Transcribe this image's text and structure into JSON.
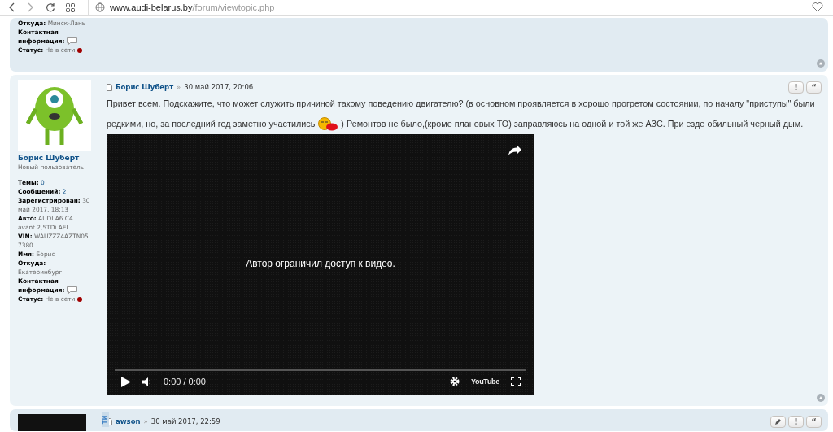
{
  "browser": {
    "url_host": "www.audi-belarus.by",
    "url_path": "/forum/viewtopic.php"
  },
  "posts": [
    {
      "kind": "tail",
      "fields": [
        {
          "label": "Откуда:",
          "value": "Минск-Лань"
        },
        {
          "label": "Контактная информация:",
          "kind": "contact"
        },
        {
          "label": "Статус:",
          "value": "Не в сети",
          "kind": "status",
          "online": false
        }
      ]
    },
    {
      "kind": "full",
      "profile_name": "Борис Шуберт",
      "author": "Борис Шуберт",
      "rank": "Новый пользователь",
      "separator": "»",
      "date": "30 май 2017, 20:06",
      "buttons": [
        {
          "kind": "text",
          "label": "!"
        },
        {
          "kind": "text",
          "label": "“"
        }
      ],
      "fields": [
        {
          "label": "Темы:",
          "value": "0",
          "link": true
        },
        {
          "label": "Сообщений:",
          "value": "2",
          "link": true
        },
        {
          "label": "Зарегистрирован:",
          "value": "30 май 2017, 18:13"
        },
        {
          "label": "Авто:",
          "value": "AUDI A6 C4 avant 2,5TDi AEL"
        },
        {
          "label": "VIN:",
          "value": "WAUZZZ4AZTN057380"
        },
        {
          "label": "Имя:",
          "value": "Борис"
        },
        {
          "label": "Откуда:",
          "value": "Екатеринбург"
        },
        {
          "label": "Контактная информация:",
          "kind": "contact"
        },
        {
          "label": "Статус:",
          "value": "Не в сети",
          "kind": "status",
          "online": false
        }
      ],
      "body_line": "Привет всем. Подскажите, что может служить причиной такому поведению двигателю? (в основном проявляется в хорошо прогретом состоянии, по началу \"приступы\" были",
      "body_before": "редкими, но, за последний год заметно участились",
      "body_after": ") Ремонтов не было,(кроме плановых ТО) заправляюсь на одной и той же АЗС. При езде обильный черный дым.",
      "video": {
        "message": "Автор ограничил доступ к видео.",
        "time": "0:00 / 0:00",
        "logo": "YouTube"
      }
    },
    {
      "kind": "head",
      "author": "awson",
      "separator": "»",
      "date": "30 май 2017, 22:59",
      "side_tab": "ТИ",
      "buttons": [
        {
          "kind": "edit"
        },
        {
          "kind": "text",
          "label": "!"
        },
        {
          "kind": "text",
          "label": "“"
        }
      ]
    }
  ]
}
